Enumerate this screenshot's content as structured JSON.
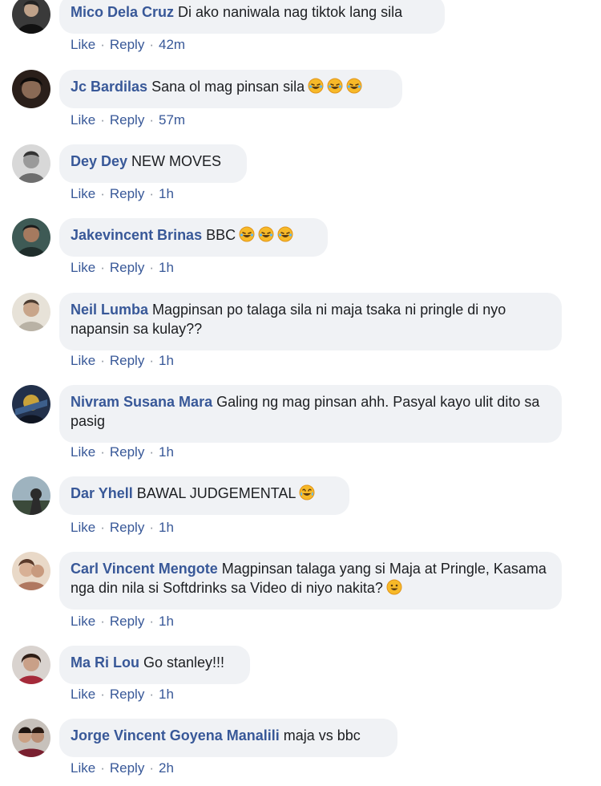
{
  "comments": [
    {
      "author": "Mico Dela Cruz",
      "text": "Di ako naniwala nag tiktok lang sila",
      "emoji": [],
      "like": "Like",
      "reply": "Reply",
      "time": "42m"
    },
    {
      "author": "Jc Bardilas",
      "text": "Sana ol mag pinsan sila",
      "emoji": [
        "rofl",
        "rofl",
        "rofl"
      ],
      "like": "Like",
      "reply": "Reply",
      "time": "57m"
    },
    {
      "author": "Dey Dey",
      "text": "NEW MOVES",
      "emoji": [],
      "like": "Like",
      "reply": "Reply",
      "time": "1h"
    },
    {
      "author": "Jakevincent Brinas",
      "text": "BBC",
      "emoji": [
        "rofl",
        "rofl",
        "rofl"
      ],
      "like": "Like",
      "reply": "Reply",
      "time": "1h"
    },
    {
      "author": "Neil Lumba",
      "text": "Magpinsan po talaga sila ni maja tsaka ni pringle di nyo napansin sa kulay??",
      "emoji": [],
      "like": "Like",
      "reply": "Reply",
      "time": "1h"
    },
    {
      "author": "Nivram Susana Mara",
      "text": "Galing ng mag pinsan ahh. Pasyal kayo ulit dito sa pasig",
      "emoji": [],
      "like": "Like",
      "reply": "Reply",
      "time": "1h"
    },
    {
      "author": "Dar Yhell",
      "text": "BAWAL JUDGEMENTAL",
      "emoji": [
        "laugh-tears"
      ],
      "like": "Like",
      "reply": "Reply",
      "time": "1h"
    },
    {
      "author": "Carl Vincent Mengote",
      "text": "Magpinsan talaga yang si Maja at Pringle, Kasama nga din nila si Softdrinks sa Video di niyo nakita?",
      "emoji": [
        "smile"
      ],
      "like": "Like",
      "reply": "Reply",
      "time": "1h"
    },
    {
      "author": "Ma Ri Lou",
      "text": "Go stanley!!!",
      "emoji": [],
      "like": "Like",
      "reply": "Reply",
      "time": "1h"
    },
    {
      "author": "Jorge Vincent Goyena Manalili",
      "text": "maja vs bbc",
      "emoji": [],
      "like": "Like",
      "reply": "Reply",
      "time": "2h"
    }
  ]
}
